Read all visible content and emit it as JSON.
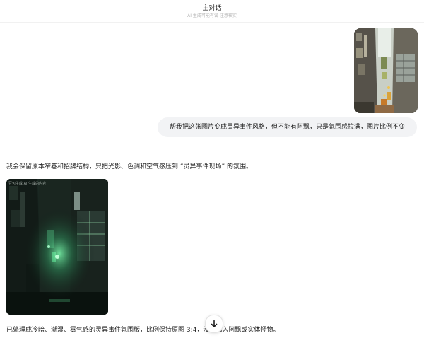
{
  "header": {
    "title": "主对话",
    "subtitle": "AI 生成可能有误 注意核实"
  },
  "user_message": {
    "text": "帮我把这张图片变成灵异事件风格，但不能有阿飘，只是氛围感拉满，图片比例不变"
  },
  "assistant_message": {
    "intro": "我会保留原本窄巷和招牌结构，只把光影、色调和空气感压到 “灵异事件现场” 的氛围。",
    "image_watermark": "豆包生成 AI 生成的内容",
    "result": "已处理成冷暗、潮湿、雾气感的灵异事件氛围版，比例保持原图 3:4，没有加入阿飘或实体怪物。"
  },
  "controls": {
    "scroll_down_icon": "arrow-down-icon"
  },
  "colors": {
    "bubble_bg": "#f2f3f5",
    "eerie_green": "#7dffb0"
  }
}
